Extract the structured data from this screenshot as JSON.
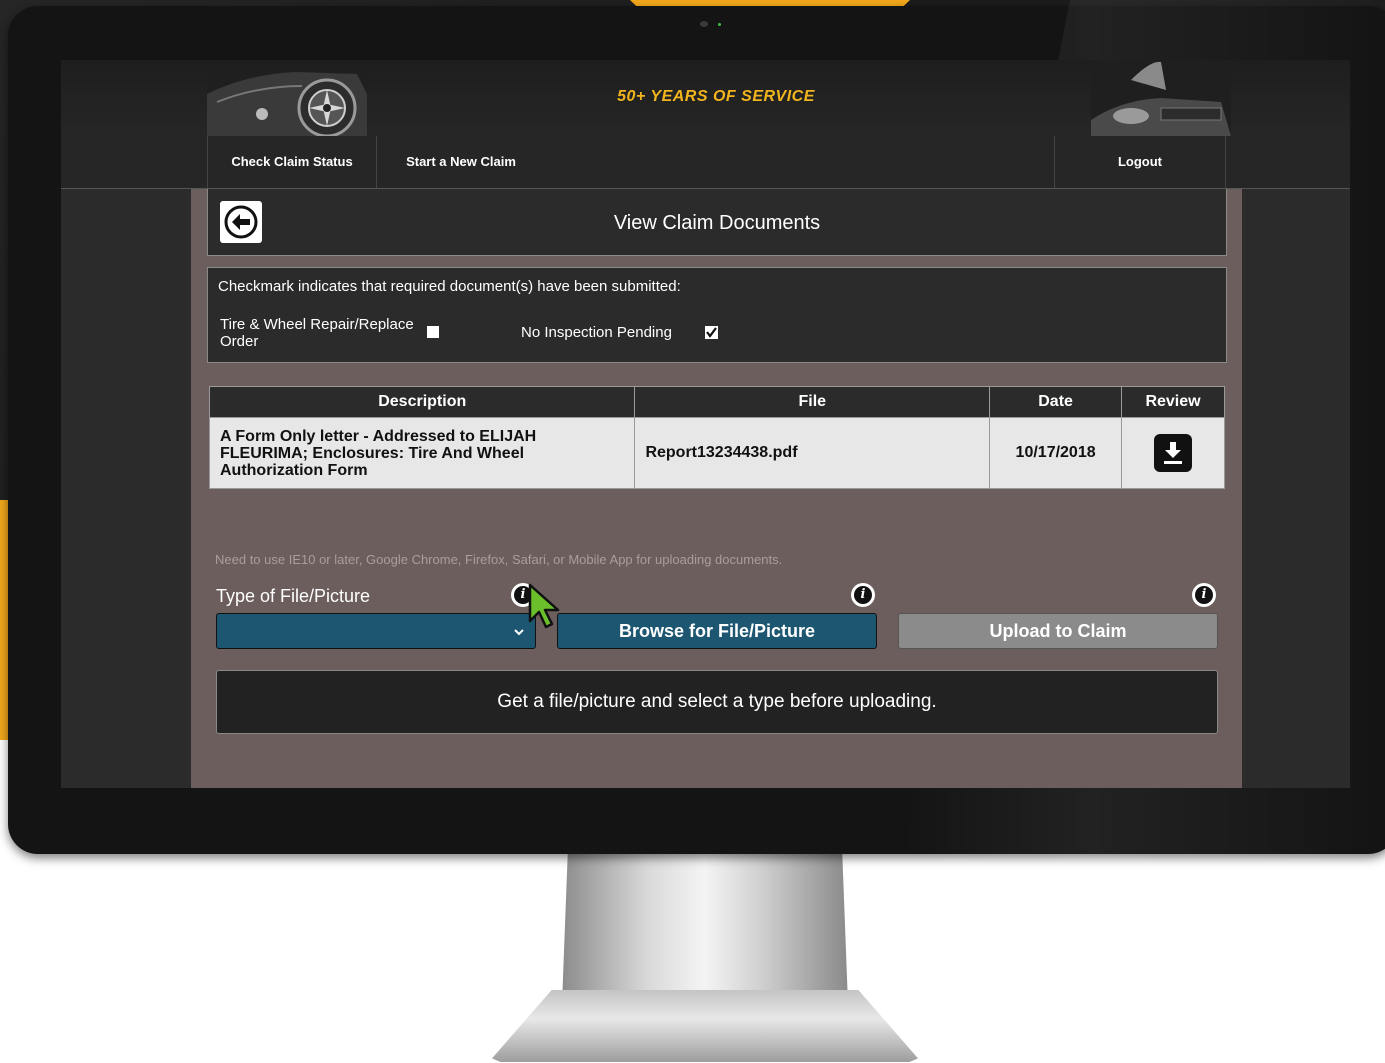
{
  "header": {
    "tagline": "50+ YEARS OF SERVICE"
  },
  "nav": {
    "items": [
      {
        "label": "Check Claim Status"
      },
      {
        "label": "Start a New Claim"
      }
    ],
    "logout_label": "Logout"
  },
  "page": {
    "title": "View Claim Documents"
  },
  "checklist": {
    "intro": "Checkmark indicates that required document(s) have been submitted:",
    "items": [
      {
        "label": "Tire & Wheel Repair/Replace Order",
        "checked": false
      },
      {
        "label": "No Inspection Pending",
        "checked": true
      }
    ]
  },
  "documents": {
    "headers": {
      "description": "Description",
      "file": "File",
      "date": "Date",
      "review": "Review"
    },
    "rows": [
      {
        "description": "A Form Only letter - Addressed to ELIJAH FLEURIMA; Enclosures: Tire And Wheel Authorization Form",
        "file": "Report13234438.pdf",
        "date": "10/17/2018",
        "review_icon": "download-icon"
      }
    ]
  },
  "upload": {
    "hint": "Need to use IE10 or later, Google Chrome, Firefox, Safari, or Mobile App for uploading documents.",
    "type_label": "Type of File/Picture",
    "type_selected": "",
    "browse_label": "Browse for File/Picture",
    "upload_label": "Upload to Claim",
    "message": "Get a file/picture and select a type before uploading.",
    "info_icon": "i"
  },
  "colors": {
    "accent_orange": "#f3a81c",
    "tagline_gold": "#f2b51e",
    "button_blue": "#1c5670",
    "button_disabled": "#8b8b8b",
    "content_bg": "#6b5e5c",
    "cursor_green": "#6abf2a"
  }
}
